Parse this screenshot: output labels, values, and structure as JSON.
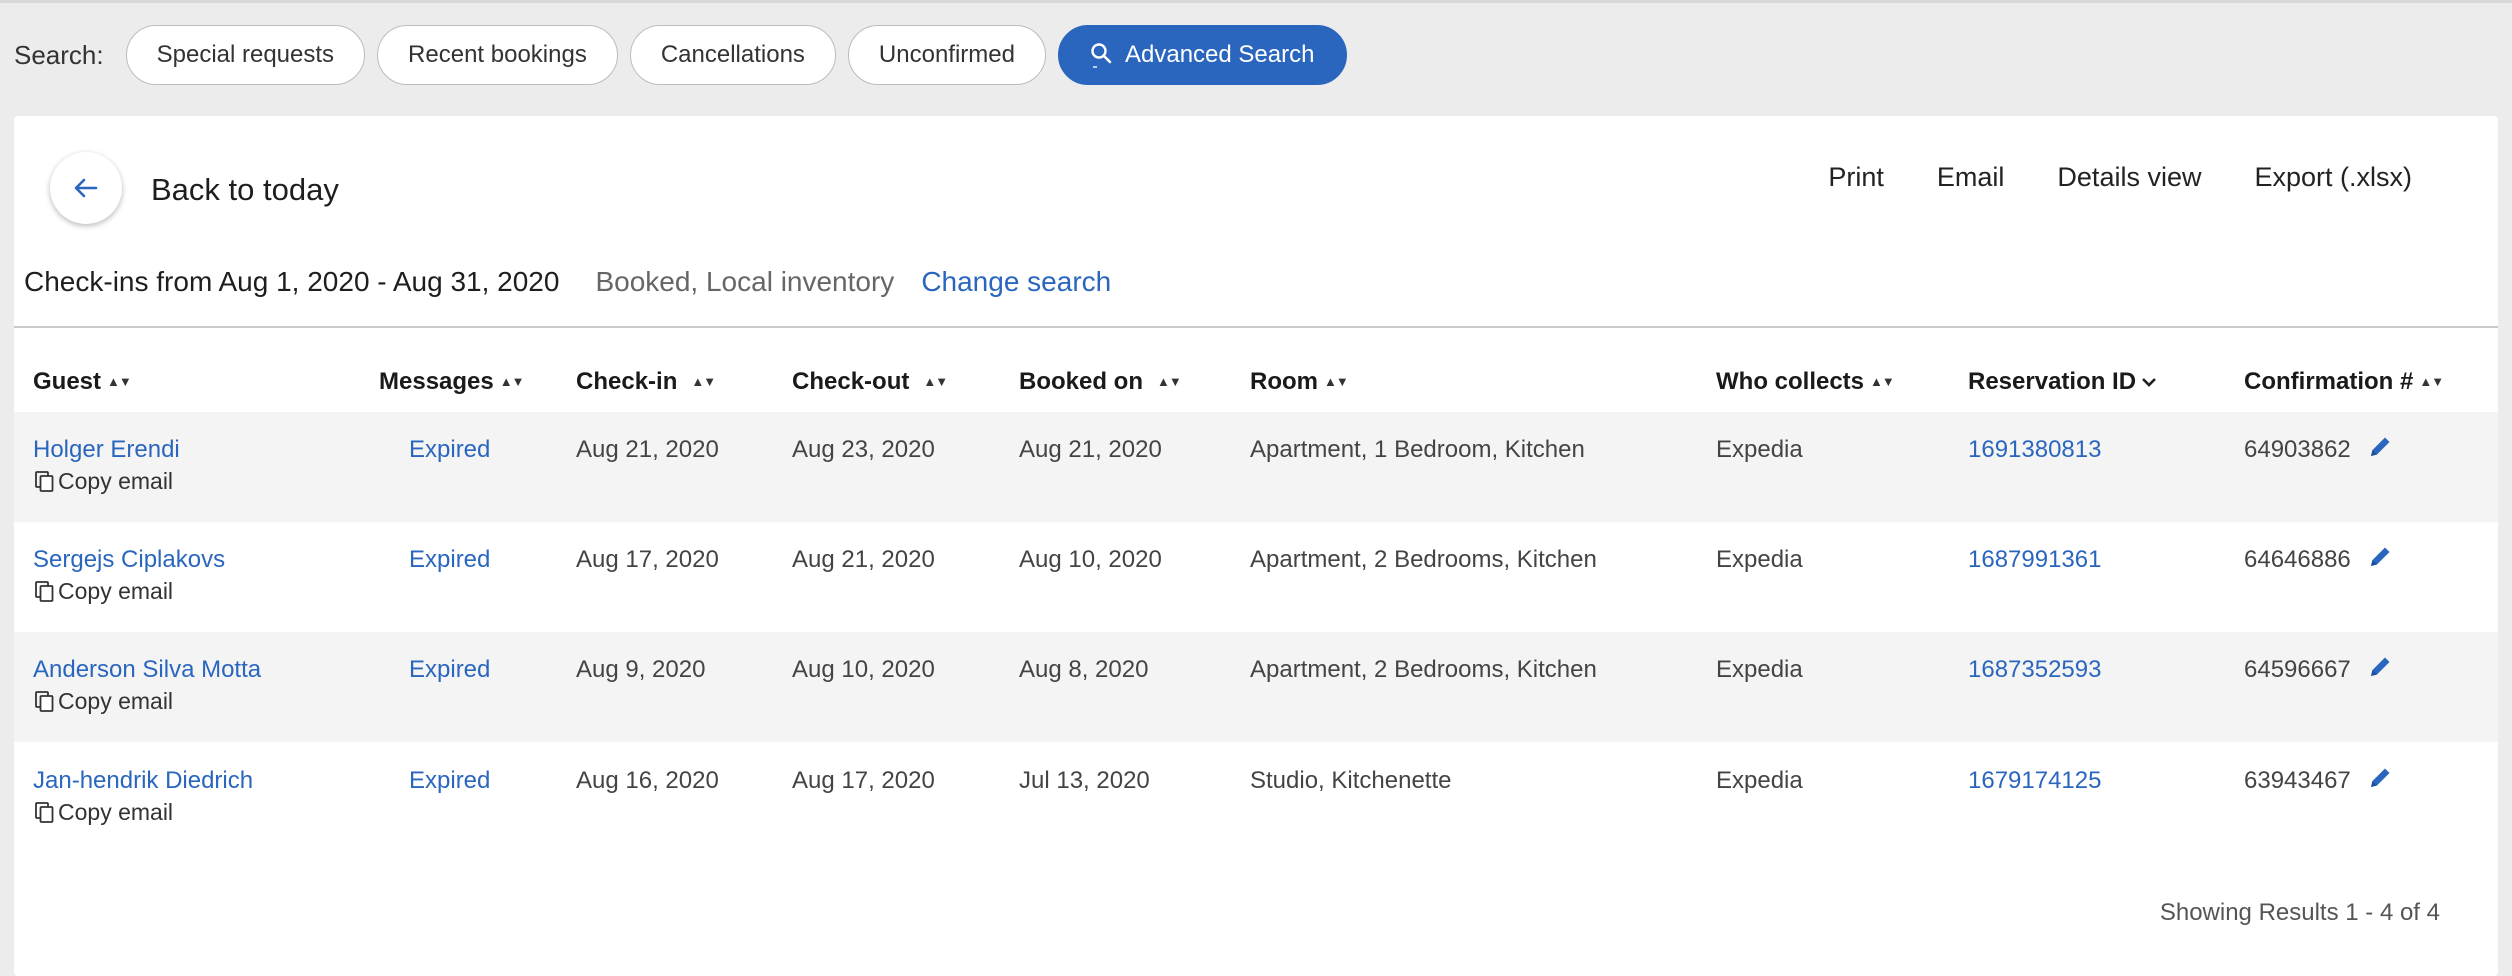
{
  "search": {
    "label": "Search:",
    "buttons": [
      "Special requests",
      "Recent bookings",
      "Cancellations",
      "Unconfirmed"
    ],
    "advanced_label": "Advanced Search"
  },
  "header": {
    "back_label": "Back to today",
    "actions": [
      "Print",
      "Email",
      "Details view",
      "Export (.xlsx)"
    ]
  },
  "summary": {
    "range": "Check-ins from Aug 1, 2020 - Aug 31, 2020",
    "filters": "Booked, Local inventory",
    "change_link": "Change search"
  },
  "table": {
    "columns": [
      "Guest",
      "Messages",
      "Check-in",
      "Check-out",
      "Booked on",
      "Room",
      "Who collects",
      "Reservation ID",
      "Confirmation #"
    ],
    "copy_label": "Copy email",
    "rows": [
      {
        "guest": "Holger Erendi",
        "messages": "Expired",
        "checkin": "Aug 21, 2020",
        "checkout": "Aug 23, 2020",
        "booked": "Aug 21, 2020",
        "room": "Apartment, 1 Bedroom, Kitchen",
        "collects": "Expedia",
        "reservation": "1691380813",
        "confirmation": "64903862"
      },
      {
        "guest": "Sergejs Ciplakovs",
        "messages": "Expired",
        "checkin": "Aug 17, 2020",
        "checkout": "Aug 21, 2020",
        "booked": "Aug 10, 2020",
        "room": "Apartment, 2 Bedrooms, Kitchen",
        "collects": "Expedia",
        "reservation": "1687991361",
        "confirmation": "64646886"
      },
      {
        "guest": "Anderson Silva Motta",
        "messages": "Expired",
        "checkin": "Aug 9, 2020",
        "checkout": "Aug 10, 2020",
        "booked": "Aug 8, 2020",
        "room": "Apartment, 2 Bedrooms, Kitchen",
        "collects": "Expedia",
        "reservation": "1687352593",
        "confirmation": "64596667"
      },
      {
        "guest": "Jan-hendrik Diedrich",
        "messages": "Expired",
        "checkin": "Aug 16, 2020",
        "checkout": "Aug 17, 2020",
        "booked": "Jul 13, 2020",
        "room": "Studio, Kitchenette",
        "collects": "Expedia",
        "reservation": "1679174125",
        "confirmation": "63943467"
      }
    ]
  },
  "footer": {
    "results": "Showing Results 1 - 4 of 4"
  },
  "colors": {
    "accent": "#2a66be",
    "row_shade": "#f4f4f4",
    "page_bg": "#ececec"
  },
  "icons": [
    "search-icon",
    "arrow-left-icon",
    "copy-icon",
    "pencil-icon",
    "sort-icon",
    "chevron-down-icon"
  ]
}
